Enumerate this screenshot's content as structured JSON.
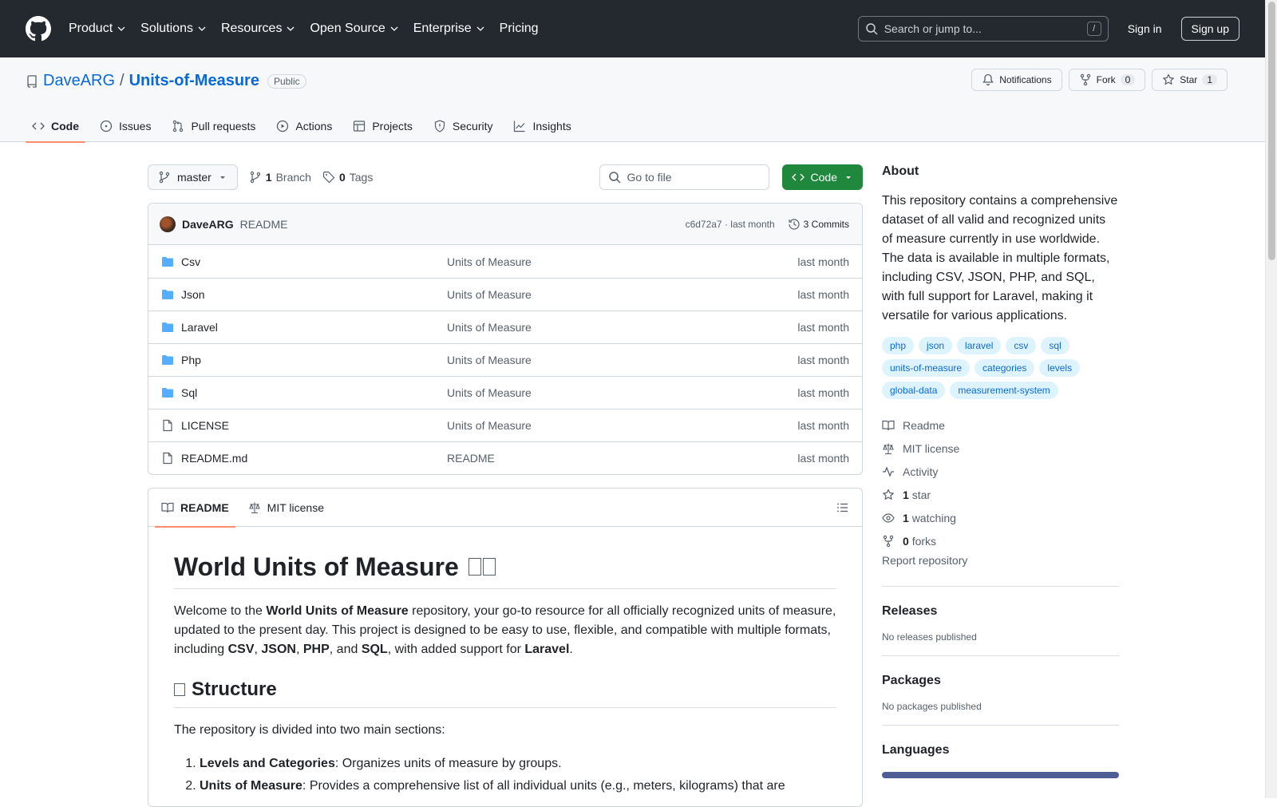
{
  "header": {
    "nav": [
      "Product",
      "Solutions",
      "Resources",
      "Open Source",
      "Enterprise",
      "Pricing"
    ],
    "search_placeholder": "Search or jump to...",
    "search_key": "/",
    "sign_in": "Sign in",
    "sign_up": "Sign up"
  },
  "repo": {
    "owner": "DaveARG",
    "separator": "/",
    "name": "Units-of-Measure",
    "visibility": "Public",
    "notifications_label": "Notifications",
    "fork_label": "Fork",
    "fork_count": "0",
    "star_label": "Star",
    "star_count": "1"
  },
  "tabs": [
    "Code",
    "Issues",
    "Pull requests",
    "Actions",
    "Projects",
    "Security",
    "Insights"
  ],
  "toolbar": {
    "branch": "master",
    "branch_count": "1",
    "branch_label": "Branch",
    "tag_count": "0",
    "tag_label": "Tags",
    "go_to_file": "Go to file",
    "code_button": "Code"
  },
  "commit": {
    "author": "DaveARG",
    "message": "README",
    "hash": "c6d72a7",
    "dot": "·",
    "time": "last month",
    "commits": "3 Commits"
  },
  "files": [
    {
      "type": "folder",
      "name": "Csv",
      "message": "Units of Measure",
      "date": "last month"
    },
    {
      "type": "folder",
      "name": "Json",
      "message": "Units of Measure",
      "date": "last month"
    },
    {
      "type": "folder",
      "name": "Laravel",
      "message": "Units of Measure",
      "date": "last month"
    },
    {
      "type": "folder",
      "name": "Php",
      "message": "Units of Measure",
      "date": "last month"
    },
    {
      "type": "folder",
      "name": "Sql",
      "message": "Units of Measure",
      "date": "last month"
    },
    {
      "type": "file",
      "name": "LICENSE",
      "message": "Units of Measure",
      "date": "last month"
    },
    {
      "type": "file",
      "name": "README.md",
      "message": "README",
      "date": "last month"
    }
  ],
  "readme": {
    "tab_readme": "README",
    "tab_license": "MIT license",
    "title": "World Units of Measure",
    "intro": [
      {
        "t": "Welcome to the "
      },
      {
        "t": "World Units of Measure",
        "b": true
      },
      {
        "t": " repository, your go-to resource for all officially recognized units of measure, updated to the present day. This project is designed to be easy to use, flexible, and compatible with multiple formats, including "
      },
      {
        "t": "CSV",
        "b": true
      },
      {
        "t": ", "
      },
      {
        "t": "JSON",
        "b": true
      },
      {
        "t": ", "
      },
      {
        "t": "PHP",
        "b": true
      },
      {
        "t": ", and "
      },
      {
        "t": "SQL",
        "b": true
      },
      {
        "t": ", with added support for "
      },
      {
        "t": "Laravel",
        "b": true
      },
      {
        "t": "."
      }
    ],
    "structure_heading": "Structure",
    "structure_intro": "The repository is divided into two main sections:",
    "list": [
      {
        "bold": "Levels and Categories",
        "rest": ": Organizes units of measure by groups."
      },
      {
        "bold": "Units of Measure",
        "rest": ": Provides a comprehensive list of all individual units (e.g., meters, kilograms) that are"
      }
    ]
  },
  "about": {
    "heading": "About",
    "description": "This repository contains a comprehensive dataset of all valid and recognized units of measure currently in use worldwide. The data is available in multiple formats, including CSV, JSON, PHP, and SQL, with full support for Laravel, making it versatile for various applications.",
    "topics": [
      "php",
      "json",
      "laravel",
      "csv",
      "sql",
      "units-of-measure",
      "categories",
      "levels",
      "global-data",
      "measurement-system"
    ],
    "links": {
      "readme": "Readme",
      "license": "MIT license",
      "activity": "Activity",
      "stars_count": "1",
      "stars_label": "star",
      "watching_count": "1",
      "watching_label": "watching",
      "forks_count": "0",
      "forks_label": "forks"
    },
    "report": "Report repository"
  },
  "releases": {
    "heading": "Releases",
    "text": "No releases published"
  },
  "packages": {
    "heading": "Packages",
    "text": "No packages published"
  },
  "languages": {
    "heading": "Languages",
    "bar_color": "#4f5d95"
  },
  "colors": {
    "header_bg": "#24292f",
    "link": "#0969da",
    "code_button": "#1f883d",
    "tab_underline": "#fd8c73"
  }
}
